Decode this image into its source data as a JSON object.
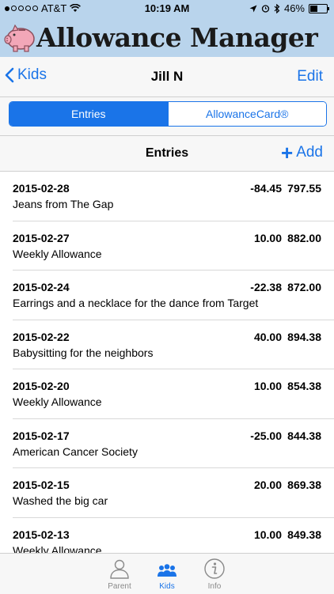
{
  "status": {
    "carrier": "AT&T",
    "time": "10:19 AM",
    "battery": "46%",
    "battery_level": 0.46
  },
  "app": {
    "title": "Allowance Manager"
  },
  "nav": {
    "back_label": "Kids",
    "title": "Jill N",
    "edit_label": "Edit"
  },
  "segments": [
    "Entries",
    "AllowanceCard®"
  ],
  "section": {
    "title": "Entries",
    "add_label": "Add"
  },
  "entries": [
    {
      "date": "2015-02-28",
      "description": "Jeans from The Gap",
      "amount": "-84.45",
      "balance": "797.55"
    },
    {
      "date": "2015-02-27",
      "description": "Weekly Allowance",
      "amount": "10.00",
      "balance": "882.00"
    },
    {
      "date": "2015-02-24",
      "description": "Earrings and a necklace for the dance from Target",
      "amount": "-22.38",
      "balance": "872.00"
    },
    {
      "date": "2015-02-22",
      "description": "Babysitting for the neighbors",
      "amount": "40.00",
      "balance": "894.38"
    },
    {
      "date": "2015-02-20",
      "description": "Weekly Allowance",
      "amount": "10.00",
      "balance": "854.38"
    },
    {
      "date": "2015-02-17",
      "description": "American Cancer Society",
      "amount": "-25.00",
      "balance": "844.38"
    },
    {
      "date": "2015-02-15",
      "description": "Washed the big car",
      "amount": "20.00",
      "balance": "869.38"
    },
    {
      "date": "2015-02-13",
      "description": "Weekly Allowance",
      "amount": "10.00",
      "balance": "849.38"
    }
  ],
  "tabs": [
    {
      "label": "Parent",
      "icon": "person-icon"
    },
    {
      "label": "Kids",
      "icon": "group-icon"
    },
    {
      "label": "Info",
      "icon": "info-icon"
    }
  ],
  "colors": {
    "accent": "#1a74e8",
    "banner": "#b9d4ec"
  }
}
